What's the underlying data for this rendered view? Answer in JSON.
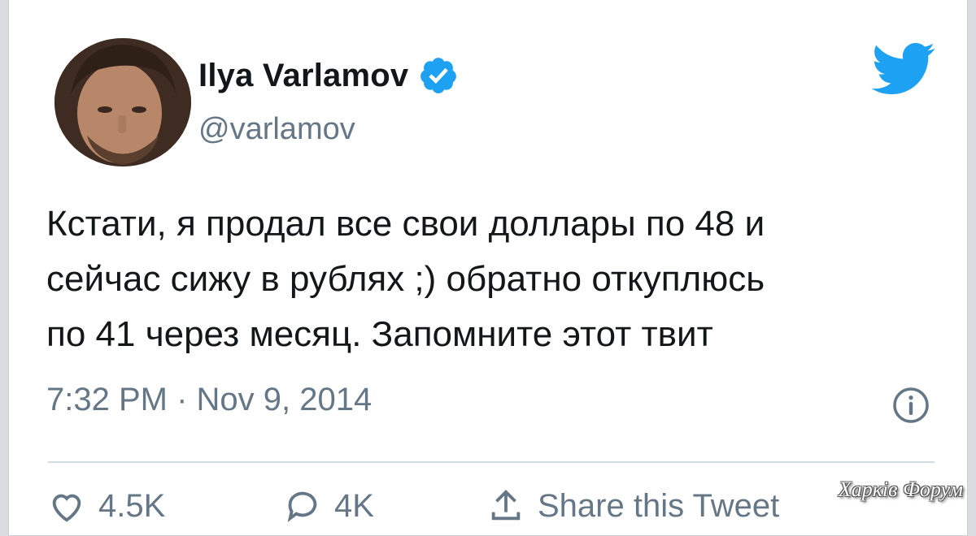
{
  "author": {
    "name": "Ilya Varlamov",
    "handle": "@varlamov",
    "verified": true
  },
  "tweet": {
    "lines": [
      "Кстати, я продал все свои доллары по 48 и",
      "сейчас сижу в рублях ;) обратно откуплюсь",
      "по 41 через месяц. Запомните этот твит"
    ],
    "timestamp": "7:32 PM · Nov 9, 2014"
  },
  "actions": {
    "likes_label": "4.5K",
    "replies_label": "4K",
    "share_label": "Share this Tweet"
  },
  "watermark": "Харків Форум",
  "colors": {
    "twitter_blue": "#1da1f2",
    "text_primary": "#14171a",
    "text_secondary": "#657786",
    "divider": "#d3dae0"
  },
  "icons": [
    "verified-badge-icon",
    "twitter-bird-icon",
    "info-icon",
    "heart-icon",
    "reply-icon",
    "share-icon"
  ]
}
